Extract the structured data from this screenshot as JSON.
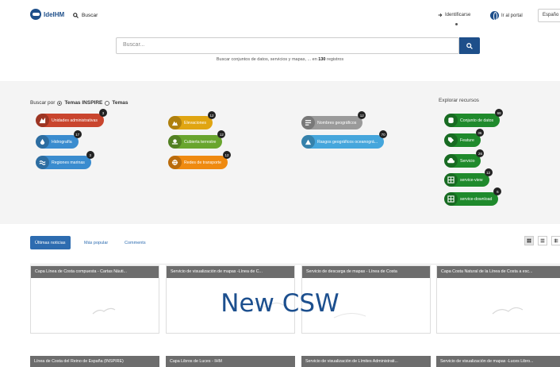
{
  "header": {
    "brand": "IdeIHM",
    "search_label": "Buscar",
    "signin_label": "Identificarse",
    "portal_label": "Ir al portal",
    "language": "Españo"
  },
  "hero": {
    "search_placeholder": "Buscar...",
    "hint_prefix": "Buscar conjuntos de datos, servicios y mapas, ... en",
    "record_count": "130",
    "hint_suffix": "registros"
  },
  "browse": {
    "label": "Buscar por",
    "option_inspire": "Temas INSPIRE",
    "option_temas": "Temas",
    "explore_title": "Explorar recursos"
  },
  "topics": [
    {
      "label": "Unidades administrativas",
      "count": "3",
      "color": "#c9452e",
      "icon": "map-icon"
    },
    {
      "label": "Hidrografía",
      "count": "17",
      "color": "#3a8ccf",
      "icon": "water-icon"
    },
    {
      "label": "Regiones marinas",
      "count": "3",
      "color": "#3a8ccf",
      "icon": "waves-icon"
    },
    {
      "label": "Elevaciones",
      "count": "12",
      "color": "#e0a512",
      "icon": "mountain-icon"
    },
    {
      "label": "Cubierta terrestre",
      "count": "12",
      "color": "#69a52e",
      "icon": "landcover-icon"
    },
    {
      "label": "Redes de transporte",
      "count": "12",
      "color": "#ef8a10",
      "icon": "transport-icon"
    },
    {
      "label": "Nombres geográficos",
      "count": "12",
      "color": "#9a9a9a",
      "icon": "names-icon"
    },
    {
      "label": "Rasgos geográficos oceanográ...",
      "count": "70",
      "color": "#45a6dc",
      "icon": "ocean-icon"
    }
  ],
  "resources": [
    {
      "label": "Conjunto de datos",
      "count": "68",
      "icon": "database-icon"
    },
    {
      "label": "Feature",
      "count": "36",
      "icon": "tag-icon"
    },
    {
      "label": "Servicio",
      "count": "26",
      "icon": "cloud-icon"
    },
    {
      "label": "service-view",
      "count": "12",
      "icon": "grid-icon"
    },
    {
      "label": "service-download",
      "count": "6",
      "icon": "grid-icon"
    }
  ],
  "news": {
    "tab_latest": "Últimas noticias",
    "tab_popular": "Más popular",
    "tab_comments": "Comments",
    "overlay": "New CSW"
  },
  "cards_row1": [
    "Capa Línea de Costa compuesta - Cartas Náuti...",
    "Servicio de visualización de mapas -Línea de C...",
    "Servicio de descarga de mapas - Línea de Costa",
    "Capa Costa Natural de la Línea de Costa a esc..."
  ],
  "cards_row2": [
    "Línea de Costa del Reino de España (INSPIRE)",
    "Capa Libros de Luces - IHM",
    "Servicio de visualización de Límites Administrati...",
    "Servicio de visualización de mapas -Luces Libro..."
  ]
}
